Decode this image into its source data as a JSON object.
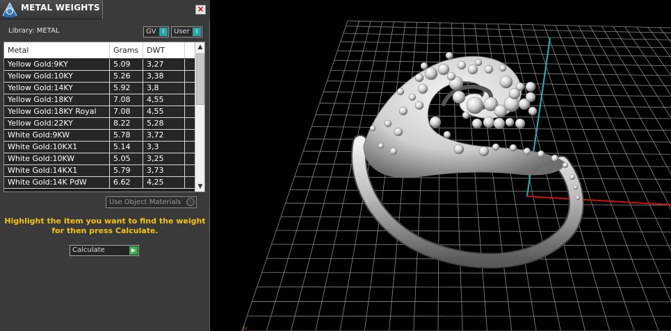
{
  "panel": {
    "title": "METAL WEIGHTS",
    "close_glyph": "×",
    "library_label": "Library: METAL",
    "toggle_gv": "GV",
    "toggle_user": "User",
    "toggle_knob": "I",
    "use_object_materials": "Use Object Materials",
    "hint_line1": "Highlight the item you want to find the weight",
    "hint_line2": "for then press Calculate.",
    "calculate_label": "Calculate",
    "calculate_glyph": "▶"
  },
  "table": {
    "columns": [
      "Metal",
      "Grams",
      "DWT"
    ],
    "rows": [
      {
        "metal": "Yellow Gold:9KY",
        "grams": "5.09",
        "dwt": "3,27"
      },
      {
        "metal": "Yellow Gold:10KY",
        "grams": "5.26",
        "dwt": "3,38"
      },
      {
        "metal": "Yellow Gold:14KY",
        "grams": "5.92",
        "dwt": "3,8"
      },
      {
        "metal": "Yellow Gold:18KY",
        "grams": "7.08",
        "dwt": "4,55"
      },
      {
        "metal": "Yellow Gold:18KY Royal",
        "grams": "7.08",
        "dwt": "4,55"
      },
      {
        "metal": "Yellow Gold:22KY",
        "grams": "8.22",
        "dwt": "5,28"
      },
      {
        "metal": "White Gold:9KW",
        "grams": "5.78",
        "dwt": "3,72"
      },
      {
        "metal": "White Gold:10KX1",
        "grams": "5.14",
        "dwt": "3,3"
      },
      {
        "metal": "White Gold:10KW",
        "grams": "5.05",
        "dwt": "3,25"
      },
      {
        "metal": "White Gold:14KX1",
        "grams": "5.79",
        "dwt": "3,73"
      },
      {
        "metal": "White Gold:14K PdW",
        "grams": "6.62",
        "dwt": "4,25"
      }
    ],
    "scroll_up": "▲",
    "scroll_down": "▼"
  },
  "colors": {
    "hint": "#f3c316",
    "toggle_knob": "#2aa6a8",
    "calculate_go": "#3ab44a",
    "axis_x": "#d01010",
    "axis_y": "#1fb8c0"
  },
  "icons": {
    "app": "app-logo-icon",
    "close": "close-icon",
    "play": "play-icon"
  }
}
